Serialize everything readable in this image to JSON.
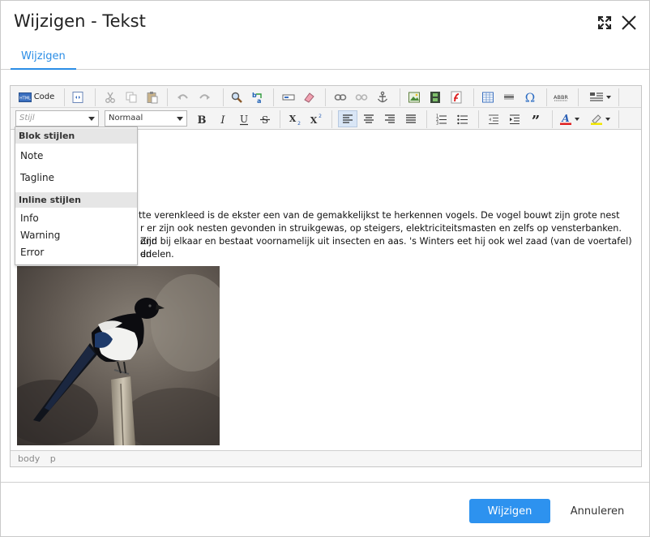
{
  "dialog": {
    "title": "Wijzigen - Tekst",
    "maximize_icon": "expand-arrows-icon",
    "close_icon": "close-x-icon"
  },
  "tabs": [
    {
      "label": "Wijzigen",
      "active": true
    }
  ],
  "toolbar": {
    "code_label": "Code",
    "style_placeholder": "Stijl",
    "format_value": "Normaal"
  },
  "style_dropdown": {
    "block_header": "Blok stijlen",
    "block_items": [
      "Note",
      "Tagline"
    ],
    "inline_header": "Inline stijlen",
    "inline_items": [
      "Info",
      "Warning",
      "Error"
    ]
  },
  "content": {
    "line1": "tte verenkleed is de ekster een van de gemakkelijkst te herkennen vogels. De vogel bouwt zijn grote nest",
    "line2": "r er zijn ook nesten gevonden in struikgewas, op steigers, elektriciteitsmasten en zelfs op vensterbanken. Zijn",
    "line3": "ond bij elkaar en bestaat voornamelijk uit insecten en aas. 's Winters eet hij ook wel zaad (van de voertafel) en",
    "line4": "ddelen.",
    "image_subject": "magpie-photo"
  },
  "pathbar": [
    "body",
    "p"
  ],
  "footer": {
    "confirm_label": "Wijzigen",
    "cancel_label": "Annuleren"
  },
  "colors": {
    "accent": "#2d92ef",
    "tab_accent": "#2a8de6",
    "toolbar_bg": "#f4f4f4",
    "font_color_bar": "#e02020",
    "highlight_bar": "#f2e600"
  }
}
